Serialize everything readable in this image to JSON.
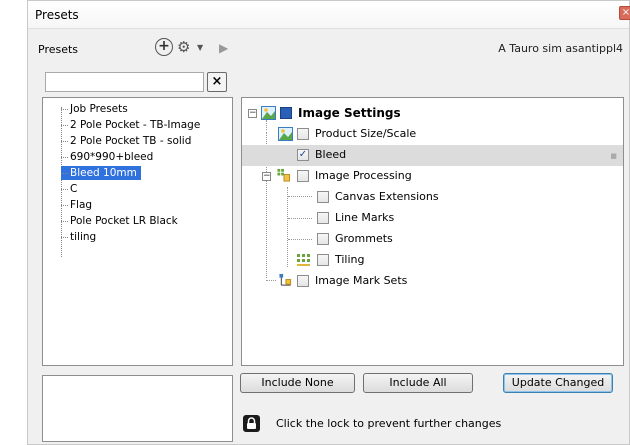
{
  "window": {
    "title": "Presets",
    "close_glyph": "×"
  },
  "presets_panel": {
    "label": "Presets",
    "search": {
      "value": "",
      "placeholder": ""
    },
    "items": [
      {
        "label": "Job Presets",
        "selected": false
      },
      {
        "label": "2 Pole Pocket - TB-Image",
        "selected": false
      },
      {
        "label": "2 Pole Pocket TB - solid",
        "selected": false
      },
      {
        "label": "690*990+bleed",
        "selected": false
      },
      {
        "label": "Bleed 10mm",
        "selected": true
      },
      {
        "label": "C",
        "selected": false
      },
      {
        "label": "Flag",
        "selected": false
      },
      {
        "label": "Pole Pocket LR Black",
        "selected": false
      },
      {
        "label": "tiling",
        "selected": false
      }
    ]
  },
  "toolbar": {
    "add_icon": "plus-circle-icon",
    "gear_icon": "gear-icon",
    "menu_icon": "chevron-down-icon",
    "play_icon": "play-icon"
  },
  "user_label": "A Tauro sim asantippl4",
  "settings_tree": {
    "root": {
      "label": "Image Settings",
      "checked": true
    },
    "items": [
      {
        "label": "Product Size/Scale",
        "checked": false
      },
      {
        "label": "Bleed",
        "checked": true
      },
      {
        "label": "Image Processing",
        "checked": false
      },
      {
        "label": "Canvas Extensions",
        "checked": false
      },
      {
        "label": "Line Marks",
        "checked": false
      },
      {
        "label": "Grommets",
        "checked": false
      },
      {
        "label": "Tiling",
        "checked": false
      },
      {
        "label": "Image Mark Sets",
        "checked": false
      }
    ]
  },
  "buttons": {
    "include_none": "Include None",
    "include_all": "Include All",
    "update_changed": "Update Changed"
  },
  "lock_hint": "Click the lock to prevent further changes",
  "glyphs": {
    "check": "✓",
    "minus": "−"
  }
}
